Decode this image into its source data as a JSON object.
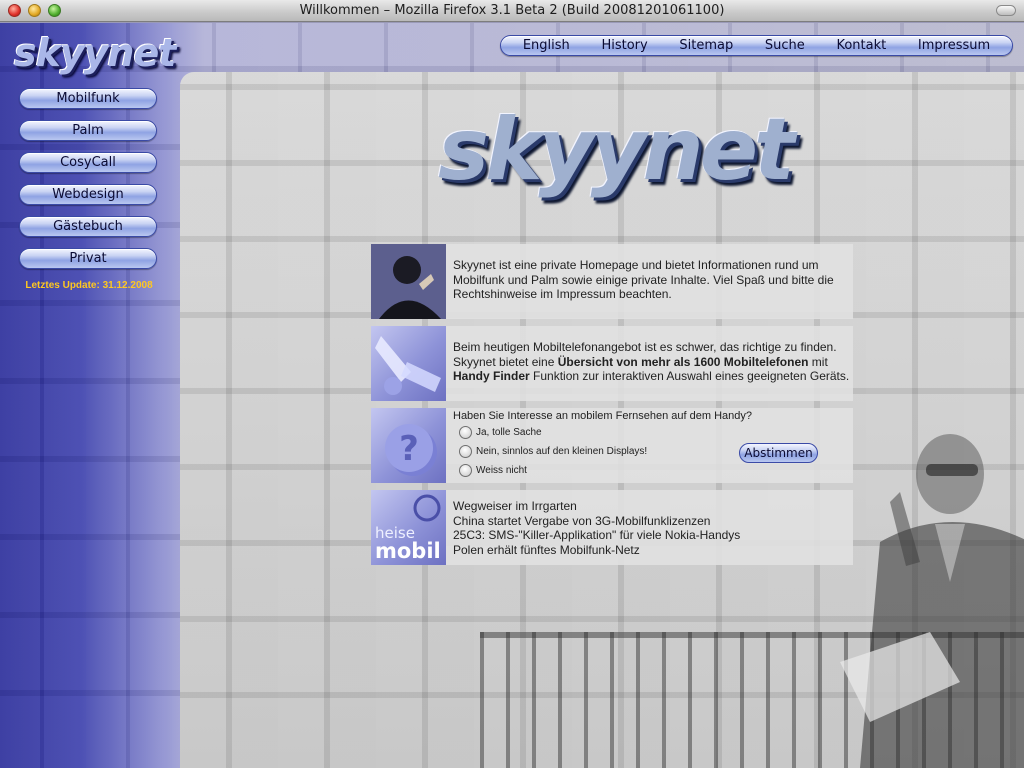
{
  "window": {
    "title": "Willkommen – Mozilla Firefox 3.1 Beta 2 (Build 20081201061100)"
  },
  "logo": {
    "text": "skyynet"
  },
  "top_nav": [
    "English",
    "History",
    "Sitemap",
    "Suche",
    "Kontakt",
    "Impressum"
  ],
  "side_nav": [
    "Mobilfunk",
    "Palm",
    "CosyCall",
    "Webdesign",
    "Gästebuch",
    "Privat"
  ],
  "last_update": "Letztes Update: 31.12.2008",
  "intro": {
    "text": "Skyynet ist eine private Homepage und bietet Informationen rund um Mobilfunk und Palm sowie einige private Inhalte. Viel Spaß und bitte die Rechtshinweise im Impressum beachten."
  },
  "finder": {
    "part1": "Beim heutigen Mobiltelefonangebot ist es schwer, das richtige zu finden. Skyynet bietet eine ",
    "bold1": "Übersicht von mehr als 1600 Mobiltelefonen",
    "part2": " mit ",
    "bold2": "Handy Finder",
    "part3": " Funktion zur interaktiven Auswahl eines geeigneten Geräts."
  },
  "poll": {
    "question": "Haben Sie Interesse an mobilem Fernsehen auf dem Handy?",
    "options": [
      "Ja, tolle Sache",
      "Nein, sinnlos auf den kleinen Displays!",
      "Weiss nicht"
    ],
    "vote_label": "Abstimmen"
  },
  "news": {
    "logo_line1": "heise",
    "logo_line2": "mobil",
    "items": [
      "Wegweiser im Irrgarten",
      "China startet Vergabe von 3G-Mobilfunklizenzen",
      "25C3: SMS-\"Killer-Applikation\" für viele Nokia-Handys",
      "Polen erhält fünftes Mobilfunk-Netz"
    ]
  },
  "colors": {
    "accent_yellow": "#ffc820",
    "nav_blue": "#8fa3e3",
    "sidebar_blue": "#2a2c9a"
  }
}
